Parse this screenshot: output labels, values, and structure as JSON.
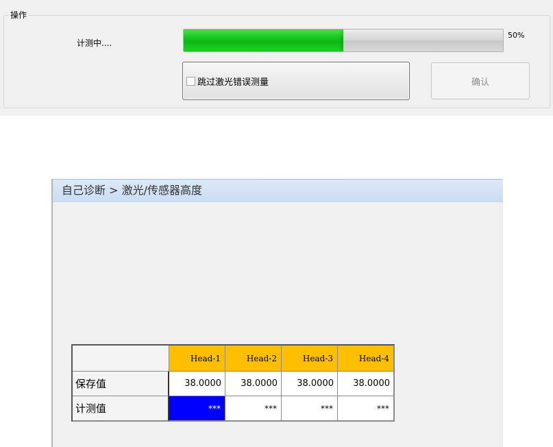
{
  "operation": {
    "group_title": "操作",
    "status_text": "计测中....",
    "progress": {
      "percent": 50,
      "label": "50%"
    },
    "skip_laser_label": "跳过激光错误测量",
    "skip_laser_checked": false,
    "confirm_label": "确认"
  },
  "diagnosis": {
    "breadcrumb": "自己诊断 > 激光/传感器高度",
    "table": {
      "headers": [
        "Head-1",
        "Head-2",
        "Head-3",
        "Head-4"
      ],
      "rows": [
        {
          "label": "保存值",
          "values": [
            "38.0000",
            "38.0000",
            "38.0000",
            "38.0000"
          ]
        },
        {
          "label": "计测值",
          "values": [
            "***",
            "***",
            "***",
            "***"
          ]
        }
      ]
    }
  },
  "colors": {
    "progress_fill": "#17c91e",
    "header_cell": "#ffbf00",
    "selected_cell": "#0000ff"
  }
}
